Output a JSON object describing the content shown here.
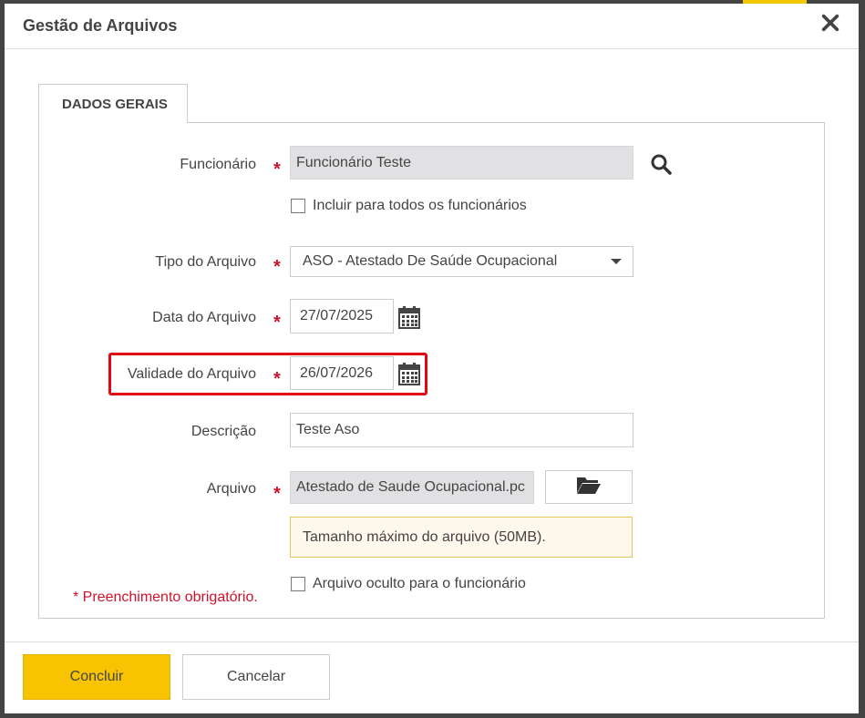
{
  "modal": {
    "title": "Gestão de Arquivos"
  },
  "tab": {
    "label": "DADOS GERAIS"
  },
  "form": {
    "funcionario": {
      "label": "Funcionário",
      "value": "Funcionário Teste",
      "required": "*"
    },
    "incluir_todos": {
      "label": "Incluir para todos os funcionários",
      "checked": false
    },
    "tipo_arquivo": {
      "label": "Tipo do Arquivo",
      "value": "ASO - Atestado De Saúde Ocupacional",
      "required": "*"
    },
    "data_arquivo": {
      "label": "Data do Arquivo",
      "value": "27/07/2025",
      "required": "*"
    },
    "validade_arquivo": {
      "label": "Validade do Arquivo",
      "value": "26/07/2026",
      "required": "*"
    },
    "descricao": {
      "label": "Descrição",
      "value": "Teste Aso"
    },
    "arquivo": {
      "label": "Arquivo",
      "value": "Atestado de Saude Ocupacional.pc",
      "required": "*",
      "size_note": "Tamanho máximo do arquivo (50MB)."
    },
    "arquivo_oculto": {
      "label": "Arquivo oculto para o funcionário",
      "checked": false
    },
    "required_note": "* Preenchimento obrigatório."
  },
  "footer": {
    "confirm_label": "Concluir",
    "cancel_label": "Cancelar"
  },
  "icons": {
    "close": "close-icon",
    "search": "search-icon",
    "calendar": "calendar-icon",
    "folder": "folder-open-icon",
    "dropdown": "chevron-down-icon"
  },
  "colors": {
    "primary_button": "#f8c300",
    "required": "#d0112b",
    "highlight": "#e30613"
  }
}
